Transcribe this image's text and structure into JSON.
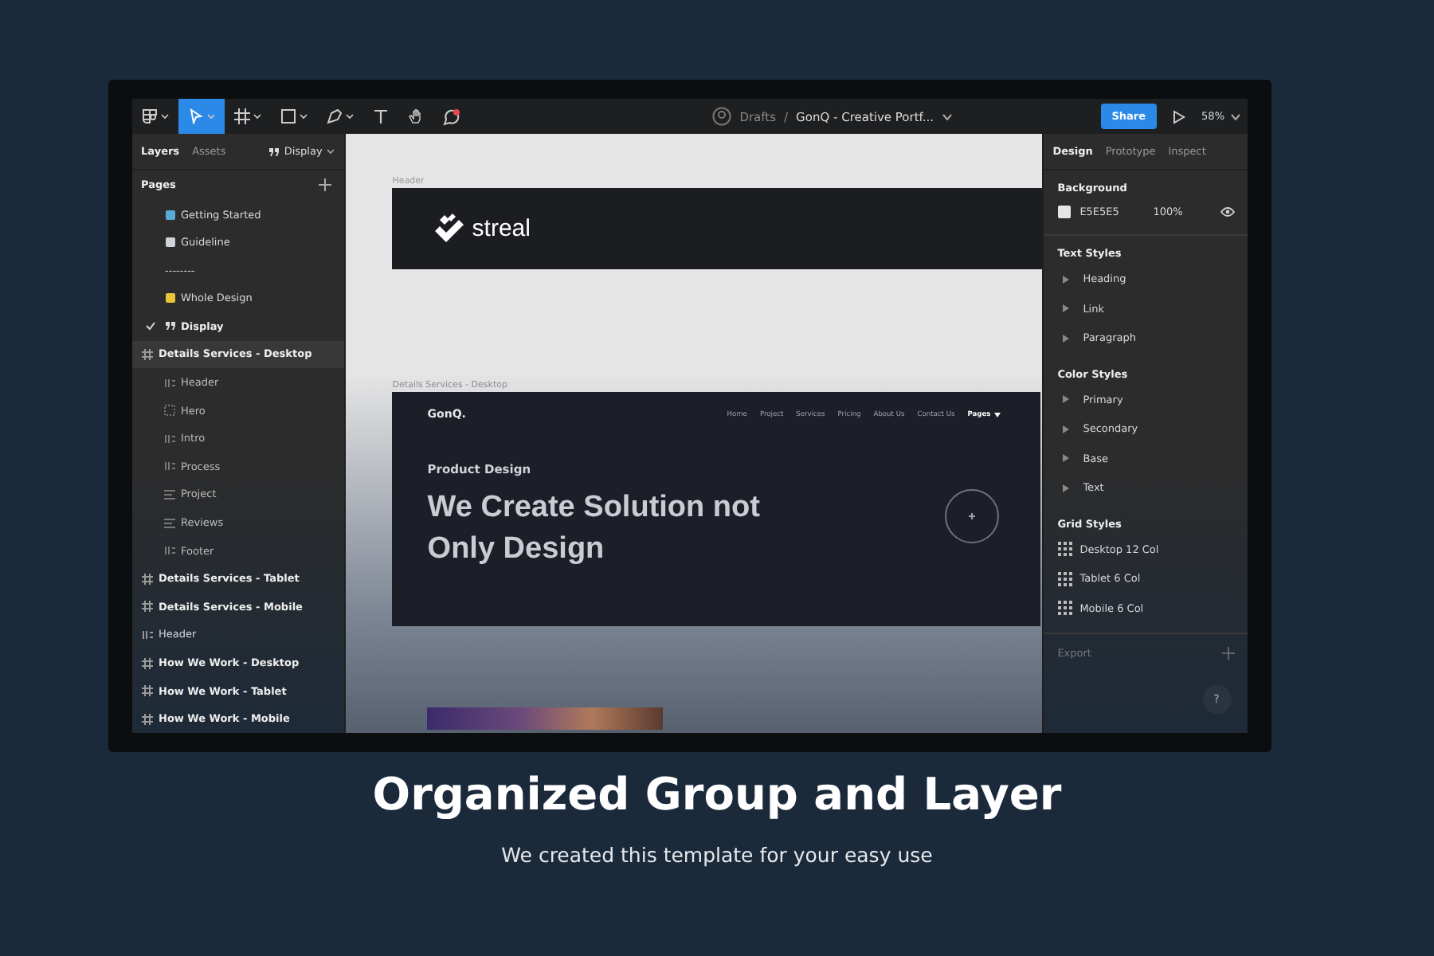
{
  "toolbar": {
    "tools": [
      {
        "kind": "menu",
        "selected": false
      },
      {
        "kind": "move",
        "selected": true
      },
      {
        "kind": "frame",
        "selected": false
      },
      {
        "kind": "rect",
        "selected": false
      },
      {
        "kind": "pen",
        "selected": false
      },
      {
        "kind": "text",
        "selected": false
      },
      {
        "kind": "hand",
        "selected": false
      },
      {
        "kind": "comment",
        "selected": false
      }
    ],
    "breadcrumb": {
      "folder": "Drafts",
      "separator": "/",
      "file": "GonQ - Creative Portf..."
    },
    "share_button": "Share",
    "zoom": "58%"
  },
  "left_panel": {
    "tabs": [
      {
        "label": "Layers",
        "selected": true
      },
      {
        "label": "Assets",
        "selected": false
      }
    ],
    "page_picker": "Display",
    "pages_title": "Pages",
    "pages": [
      {
        "label": "Getting Started",
        "kind": "globe",
        "selected": false
      },
      {
        "label": "Guideline",
        "kind": "book",
        "selected": false
      },
      {
        "label": "--------",
        "kind": "divider",
        "selected": false
      },
      {
        "label": "Whole Design",
        "kind": "folder",
        "selected": false
      },
      {
        "label": "Display",
        "kind": "quote",
        "selected": true
      }
    ],
    "layers": [
      {
        "label": "Details Services - Desktop",
        "kind": "frame",
        "children": [
          {
            "label": "Header",
            "kind": "component"
          },
          {
            "label": "Hero",
            "kind": "group"
          },
          {
            "label": "Intro",
            "kind": "component"
          },
          {
            "label": "Process",
            "kind": "component"
          },
          {
            "label": "Project",
            "kind": "lines"
          },
          {
            "label": "Reviews",
            "kind": "lines"
          },
          {
            "label": "Footer",
            "kind": "component"
          }
        ]
      },
      {
        "label": "Details Services - Tablet",
        "kind": "frame"
      },
      {
        "label": "Details Services - Mobile",
        "kind": "frame"
      },
      {
        "label": "Header",
        "kind": "component"
      },
      {
        "label": "How We Work - Desktop",
        "kind": "frame"
      },
      {
        "label": "How We Work - Tablet",
        "kind": "frame"
      },
      {
        "label": "How We Work - Mobile",
        "kind": "frame"
      }
    ]
  },
  "canvas": {
    "header_frame": {
      "label": "Header",
      "logo_text": "streal"
    },
    "desktop_frame": {
      "label": "Details Services - Desktop",
      "brand": "GonQ.",
      "nav": [
        "Home",
        "Project",
        "Services",
        "Pricing",
        "About Us",
        "Contact Us"
      ],
      "nav_dropdown": "Pages",
      "eyebrow": "Product Design",
      "headline": "We Create Solution not Only Design"
    }
  },
  "right_panel": {
    "tabs": [
      {
        "label": "Design",
        "selected": true
      },
      {
        "label": "Prototype",
        "selected": false
      },
      {
        "label": "Inspect",
        "selected": false
      }
    ],
    "background": {
      "title": "Background",
      "color": "#e5e5e5",
      "hex": "E5E5E5",
      "opacity": "100%"
    },
    "text_styles": {
      "title": "Text Styles",
      "items": [
        "Heading",
        "Link",
        "Paragraph"
      ]
    },
    "color_styles": {
      "title": "Color Styles",
      "items": [
        "Primary",
        "Secondary",
        "Base",
        "Text"
      ]
    },
    "grid_styles": {
      "title": "Grid Styles",
      "items": [
        "Desktop 12 Col",
        "Tablet 6 Col",
        "Mobile 6 Col"
      ]
    },
    "export": "Export",
    "help": "?"
  },
  "caption": {
    "title": "Organized Group and Layer",
    "subtitle": "We created this template for your easy use"
  }
}
